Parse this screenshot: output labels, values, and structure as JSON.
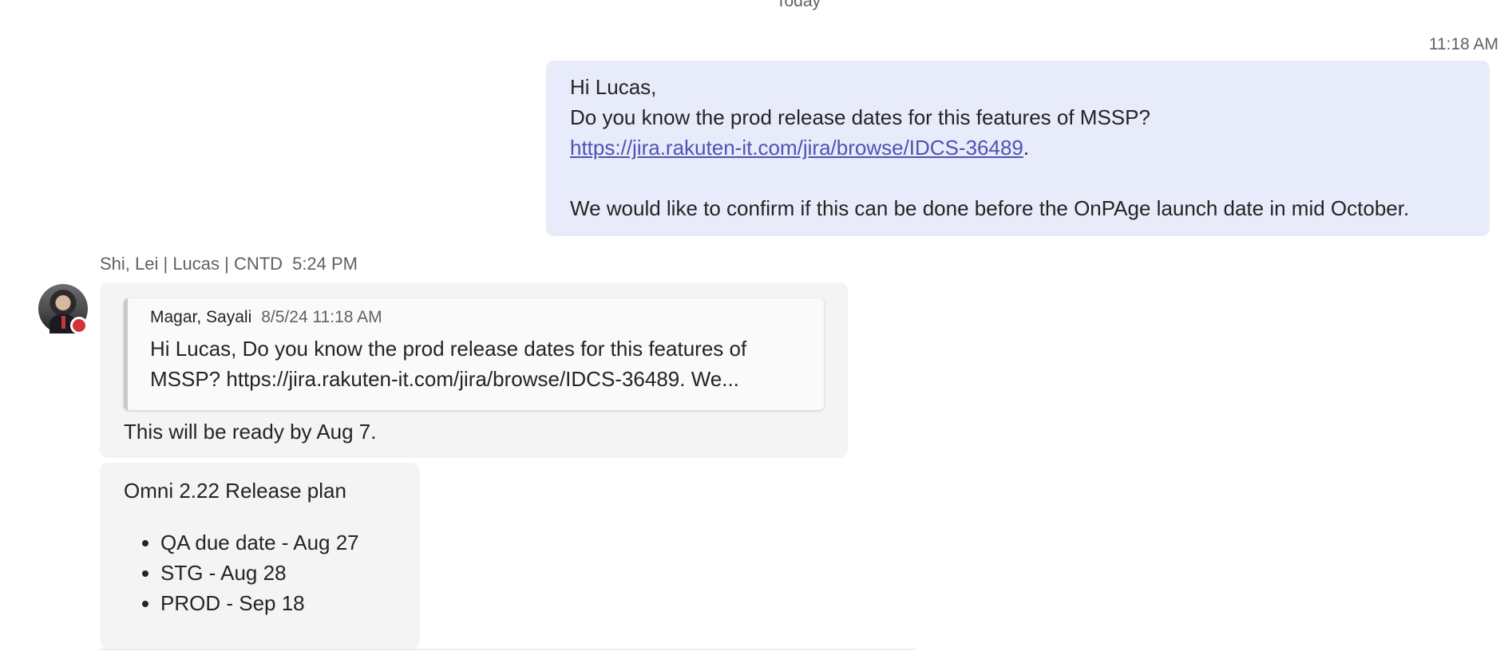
{
  "divider": {
    "label": "Today"
  },
  "sent_message": {
    "time": "11:18 AM",
    "greeting": "Hi Lucas,",
    "question": "Do you know the prod release dates for this features of MSSP?",
    "link": "https://jira.rakuten-it.com/jira/browse/IDCS-36489",
    "link_suffix": ".",
    "closing": "We would like to confirm if this can be done before the OnPAge launch date in mid October."
  },
  "reply_message": {
    "sender": "Shi, Lei | Lucas | CNTD",
    "time": "5:24 PM",
    "presence_status": "busy",
    "presence_color": "#d13438",
    "quote": {
      "author": "Magar, Sayali",
      "date": "8/5/24 11:18 AM",
      "text_line1": "Hi Lucas, Do you know the prod release dates for this features of",
      "text_line2": "MSSP? https://jira.rakuten-it.com/jira/browse/IDCS-36489. We..."
    },
    "text": "This will be ready by Aug 7."
  },
  "plan_message": {
    "title": "Omni 2.22 Release plan",
    "items": [
      "QA due date - Aug 27",
      "STG - Aug 28",
      "PROD - Sep 18"
    ]
  },
  "colors": {
    "sent_bubble": "#e8ebfa",
    "received_bubble": "#f4f4f4",
    "link": "#4f52b2"
  }
}
